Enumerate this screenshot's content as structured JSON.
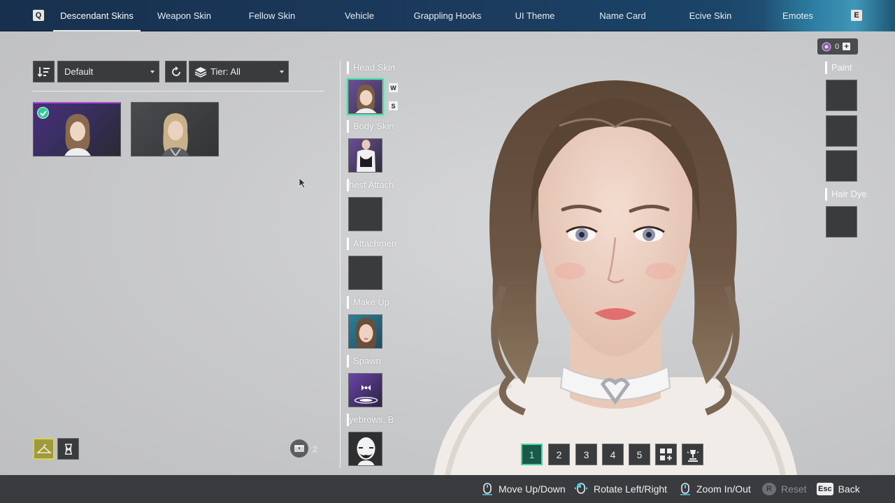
{
  "nav": {
    "left_key": "Q",
    "right_key": "E",
    "tabs": [
      {
        "label": "Descendant Skins"
      },
      {
        "label": "Weapon Skin"
      },
      {
        "label": "Fellow Skin"
      },
      {
        "label": "Vehicle"
      },
      {
        "label": "Grappling Hooks"
      },
      {
        "label": "UI Theme"
      },
      {
        "label": "Name Card"
      },
      {
        "label": "Ecive Skin"
      },
      {
        "label": "Emotes"
      }
    ],
    "active_tab": "Descendant Skins"
  },
  "filters": {
    "sort_icon": "sort-descending-icon",
    "sort_value": "Default",
    "reset_icon": "refresh-icon",
    "tier_icon": "layers-icon",
    "tier_value": "Tier: All"
  },
  "skins": [
    {
      "name": "skin-1",
      "equipped": true
    },
    {
      "name": "skin-2",
      "equipped": false
    }
  ],
  "left_bottom": {
    "wardrobe_icon": "hanger-icon",
    "hourglass_icon": "hourglass-icon",
    "storage_icon": "chest-icon",
    "storage_count": "2"
  },
  "slots": [
    {
      "label": "Head Skin",
      "filled": true,
      "selected": true
    },
    {
      "label": "Body Skin",
      "filled": true,
      "selected": false
    },
    {
      "label": "Chest Attachment",
      "shown": "hest Attach",
      "filled": false,
      "selected": false
    },
    {
      "label": "Attachment",
      "shown": "Attachmen",
      "filled": false,
      "selected": false
    },
    {
      "label": "Make Up",
      "filled": true,
      "selected": false
    },
    {
      "label": "Spawn",
      "filled": true,
      "selected": false
    },
    {
      "label": "Eyebrows, Beard",
      "shown": "yebrows, B",
      "filled": true,
      "selected": false
    }
  ],
  "slot_tags": {
    "w": "W",
    "s": "S"
  },
  "right": {
    "currency_value": "0",
    "paint_label": "Paint",
    "hair_dye_label": "Hair Dye"
  },
  "presets": {
    "items": [
      "1",
      "2",
      "3",
      "4",
      "5"
    ],
    "active": "1",
    "add_icon": "grid-add-icon",
    "light_icon": "lighting-icon"
  },
  "hints": {
    "move": {
      "label": "Move Up/Down"
    },
    "rotate": {
      "label": "Rotate Left/Right"
    },
    "zoom": {
      "label": "Zoom In/Out"
    },
    "reset": {
      "key": "R",
      "label": "Reset"
    },
    "back": {
      "key": "Esc",
      "label": "Back"
    }
  },
  "colors": {
    "accent": "#44d5a8",
    "panel": "#3a3b3d",
    "nav": "#1b3a5c"
  }
}
